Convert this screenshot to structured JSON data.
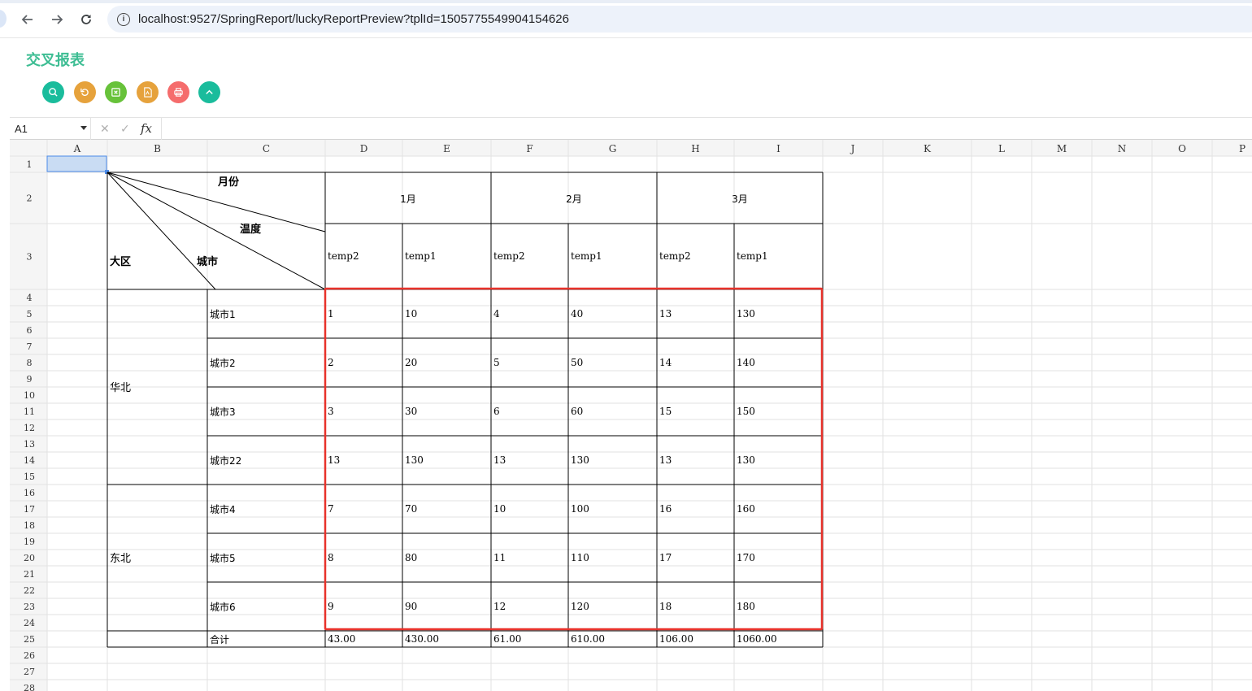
{
  "browser": {
    "url": "localhost:9527/SpringReport/luckyReportPreview?tplId=1505775549904154626"
  },
  "page": {
    "title": "交叉报表",
    "toolbar": [
      {
        "name": "search-button",
        "icon": "search-icon",
        "color": "#1abc9c"
      },
      {
        "name": "refresh-button",
        "icon": "refresh-icon",
        "color": "#e6a23c"
      },
      {
        "name": "export-excel-button",
        "icon": "excel-icon",
        "color": "#67c23a"
      },
      {
        "name": "export-pdf-button",
        "icon": "pdf-icon",
        "color": "#e6a23c"
      },
      {
        "name": "print-button",
        "icon": "print-icon",
        "color": "#f56c6c"
      },
      {
        "name": "collapse-button",
        "icon": "chevron-up-icon",
        "color": "#1abc9c"
      }
    ]
  },
  "formula_bar": {
    "name_box": "A1",
    "cancel_icon": "✕",
    "confirm_icon": "✓",
    "fx": "fx"
  },
  "sheet": {
    "columns": [
      "A",
      "B",
      "C",
      "D",
      "E",
      "F",
      "G",
      "H",
      "I",
      "J",
      "K",
      "L",
      "M",
      "N",
      "O",
      "P"
    ],
    "rows": [
      "1",
      "2",
      "3",
      "4",
      "5",
      "6",
      "7",
      "8",
      "9",
      "10",
      "11",
      "12",
      "13",
      "14",
      "15",
      "16",
      "17",
      "18",
      "19",
      "20",
      "21",
      "22",
      "23",
      "24",
      "25",
      "26",
      "27",
      "28"
    ],
    "header": {
      "month": "月份",
      "temperature": "温度",
      "region": "大区",
      "city": "城市",
      "months": [
        "1月",
        "2月",
        "3月"
      ],
      "temps": [
        "temp2",
        "temp1",
        "temp2",
        "temp1",
        "temp2",
        "temp1"
      ]
    },
    "groups": [
      {
        "region": "华北",
        "rows": [
          {
            "city": "城市1",
            "values": [
              "1",
              "10",
              "4",
              "40",
              "13",
              "130"
            ]
          },
          {
            "city": "城市2",
            "values": [
              "2",
              "20",
              "5",
              "50",
              "14",
              "140"
            ]
          },
          {
            "city": "城市3",
            "values": [
              "3",
              "30",
              "6",
              "60",
              "15",
              "150"
            ]
          },
          {
            "city": "城市22",
            "values": [
              "13",
              "130",
              "13",
              "130",
              "13",
              "130"
            ]
          }
        ]
      },
      {
        "region": "东北",
        "rows": [
          {
            "city": "城市4",
            "values": [
              "7",
              "70",
              "10",
              "100",
              "16",
              "160"
            ]
          },
          {
            "city": "城市5",
            "values": [
              "8",
              "80",
              "11",
              "110",
              "17",
              "170"
            ]
          },
          {
            "city": "城市6",
            "values": [
              "9",
              "90",
              "12",
              "120",
              "18",
              "180"
            ]
          }
        ]
      }
    ],
    "total": {
      "label": "合计",
      "values": [
        "43.00",
        "430.00",
        "61.00",
        "610.00",
        "106.00",
        "1060.00"
      ]
    },
    "highlight_color": "#e8322b",
    "selected_cell": "A1"
  }
}
